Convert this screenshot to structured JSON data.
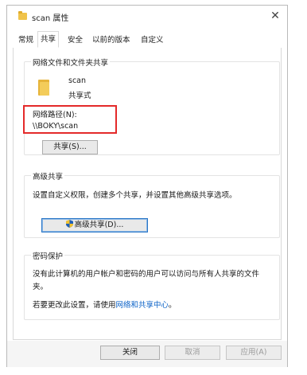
{
  "window": {
    "title": "scan 属性",
    "close_glyph": "✕"
  },
  "tabs": [
    {
      "label": "常规",
      "active": false
    },
    {
      "label": "共享",
      "active": true
    },
    {
      "label": "安全",
      "active": false
    },
    {
      "label": "以前的版本",
      "active": false
    },
    {
      "label": "自定义",
      "active": false
    }
  ],
  "network_sharing": {
    "group_title": "网络文件和文件夹共享",
    "folder_name": "scan",
    "share_status": "共享式",
    "path_label": "网络路径(N):",
    "path_value": "\\\\BOKY\\scan",
    "share_button": "共享(S)..."
  },
  "advanced_sharing": {
    "group_title": "高级共享",
    "description": "设置自定义权限，创建多个共享，并设置其他高级共享选项。",
    "button": "高级共享(D)..."
  },
  "password_protection": {
    "group_title": "密码保护",
    "description_line1": "没有此计算机的用户帐户和密码的用户可以访问与所有人共享的文件",
    "description_line2": "夹。",
    "change_prefix": "若要更改此设置，请使用",
    "change_link": "网络和共享中心",
    "change_suffix": "。"
  },
  "footer": {
    "close_button": "关闭",
    "cancel_button": "取消",
    "apply_button": "应用(A)"
  },
  "colors": {
    "highlight_border": "#e42a2a",
    "link": "#0b62c7",
    "folder": "#f3cc5a"
  },
  "icons": {
    "title": "folder-icon",
    "close": "close-icon",
    "folder": "folder-icon",
    "shield": "uac-shield-icon"
  }
}
